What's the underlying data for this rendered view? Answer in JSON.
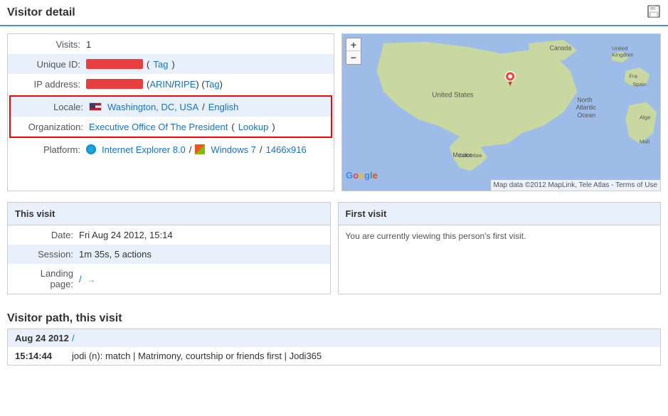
{
  "header": {
    "title": "Visitor detail",
    "save_tooltip": "Save"
  },
  "visitor_info": {
    "visits_label": "Visits:",
    "visits_value": "1",
    "unique_id_label": "Unique ID:",
    "tag_link": "Tag",
    "ip_address_label": "IP address:",
    "arin_link": "ARIN",
    "ripe_link": "RIPE",
    "ip_tag_link": "Tag",
    "locale_label": "Locale:",
    "locale_location": "Washington, DC, USA",
    "locale_separator": "/",
    "locale_language": "English",
    "org_label": "Organization:",
    "org_name": "Executive Office Of The President",
    "lookup_link": "Lookup",
    "platform_label": "Platform:",
    "browser": "Internet Explorer 8.0",
    "platform_separator1": "/",
    "os": "Windows 7",
    "platform_separator2": "/",
    "resolution": "1466x916"
  },
  "this_visit": {
    "title": "This visit",
    "date_label": "Date:",
    "date_value": "Fri Aug 24 2012, 15:14",
    "session_label": "Session:",
    "session_value": "1m 35s, 5 actions",
    "landing_label": "Landing page:",
    "landing_value": "/"
  },
  "first_visit": {
    "title": "First visit",
    "message": "You are currently viewing this person's first visit."
  },
  "visitor_path": {
    "title": "Visitor path, this visit",
    "rows": [
      {
        "date": "Aug 24 2012",
        "value": "/"
      },
      {
        "date": "15:14:44",
        "value": "jodi (n): match | Matrimony, courtship or friends first | Jodi365"
      }
    ]
  },
  "map": {
    "zoom_in": "+",
    "zoom_out": "−",
    "footer": "Map data ©2012 MapLink, Tele Atlas - Terms of Use",
    "google_label": "Google"
  }
}
